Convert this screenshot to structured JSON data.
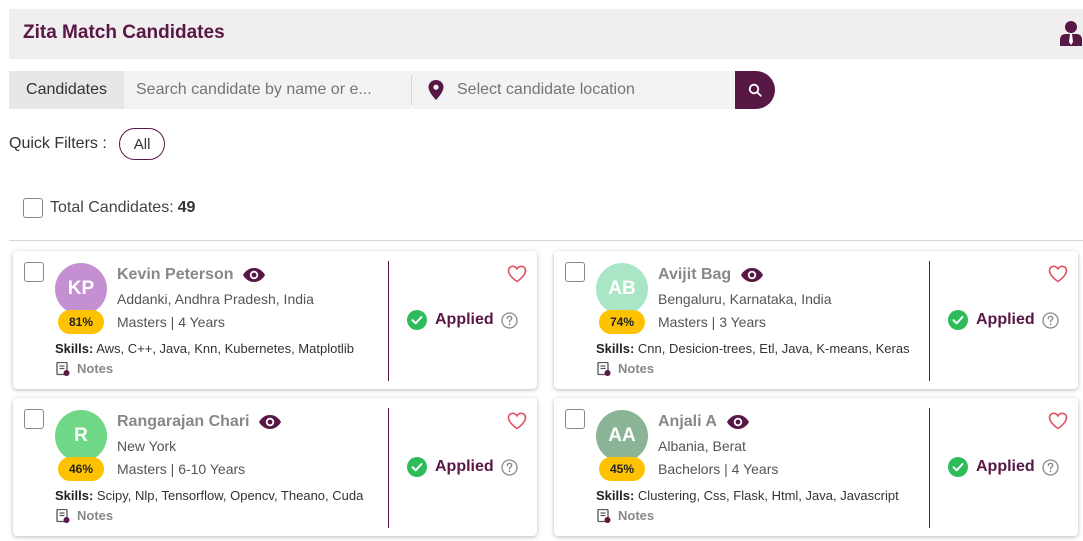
{
  "header": {
    "title": "Zita Match Candidates"
  },
  "search": {
    "label": "Candidates",
    "name_placeholder": "Search candidate by name or e...",
    "location_placeholder": "Select candidate location"
  },
  "quick_filters": {
    "label": "Quick Filters :",
    "chip": "All"
  },
  "total": {
    "label": "Total Candidates:",
    "count": "49"
  },
  "colors": {
    "brand": "#581845",
    "match_badge": "#ffc200",
    "applied_green": "#2ebc5b",
    "heart": "#e05263"
  },
  "candidates": [
    {
      "initials": "KP",
      "name": "Kevin Peterson",
      "location": "Addanki, Andhra Pradesh, India",
      "education": "Masters | 4 Years",
      "match": "81%",
      "skills_label": "Skills:",
      "skills": "Aws, C++, Java, Knn, Kubernetes, Matplotlib",
      "notes": "Notes",
      "status": "Applied",
      "avatar_color": "#c490d1"
    },
    {
      "initials": "AB",
      "name": "Avijit Bag",
      "location": "Bengaluru, Karnataka, India",
      "education": "Masters | 3 Years",
      "match": "74%",
      "skills_label": "Skills:",
      "skills": "Cnn, Desicion-trees, Etl, Java, K-means, Keras",
      "notes": "Notes",
      "status": "Applied",
      "avatar_color": "#a8e6c6"
    },
    {
      "initials": "R",
      "name": "Rangarajan Chari",
      "location": "New York",
      "education": "Masters | 6-10 Years",
      "match": "46%",
      "skills_label": "Skills:",
      "skills": "Scipy, Nlp, Tensorflow, Opencv, Theano, Cuda",
      "notes": "Notes",
      "status": "Applied",
      "avatar_color": "#6fd886"
    },
    {
      "initials": "AA",
      "name": "Anjali A",
      "location": "Albania, Berat",
      "education": "Bachelors | 4 Years",
      "match": "45%",
      "skills_label": "Skills:",
      "skills": "Clustering, Css, Flask, Html, Java, Javascript",
      "notes": "Notes",
      "status": "Applied",
      "avatar_color": "#8bb396"
    }
  ]
}
